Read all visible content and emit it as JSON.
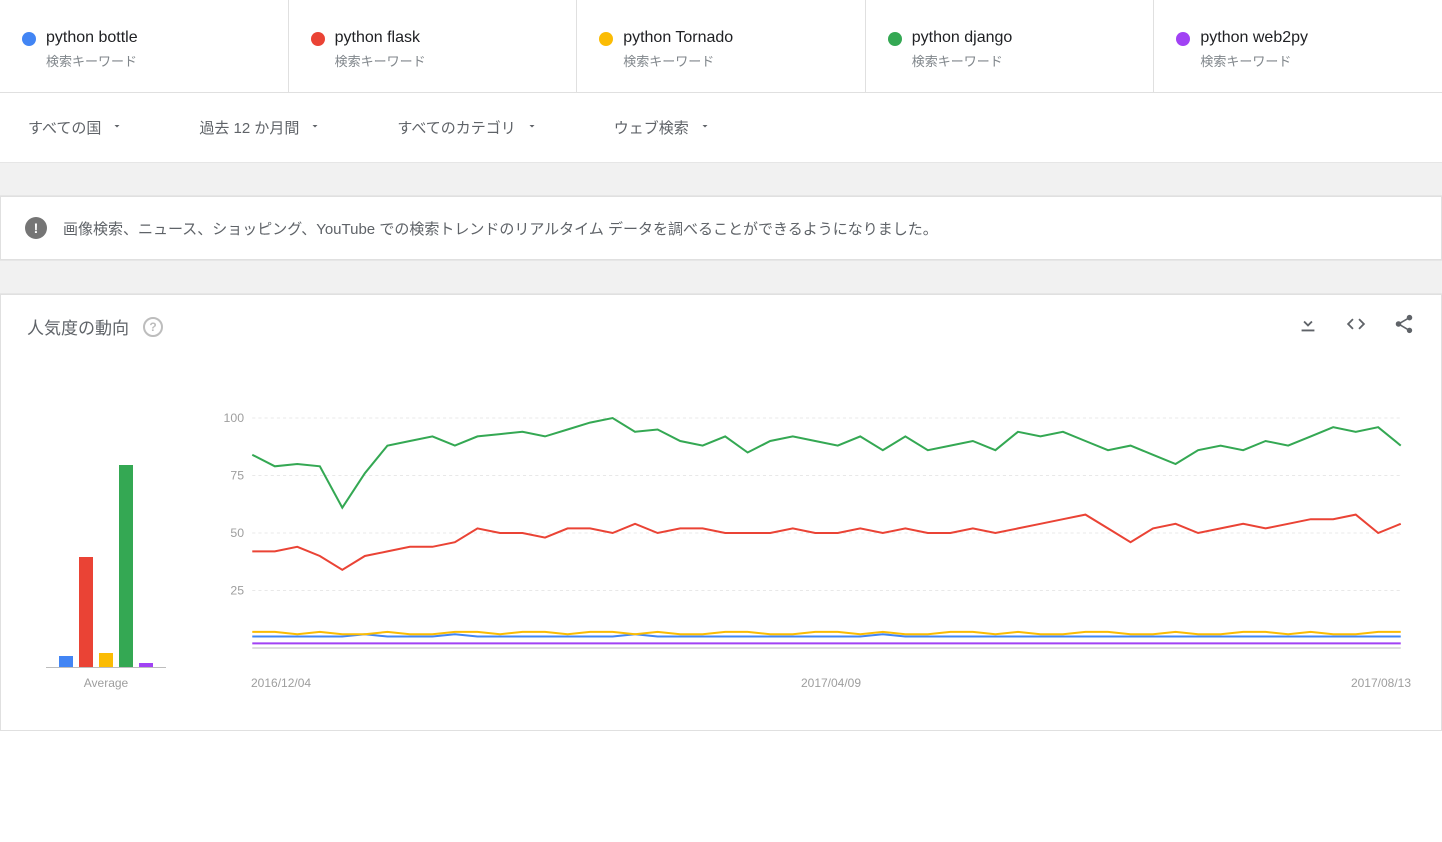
{
  "terms": [
    {
      "label": "python bottle",
      "sub": "検索キーワード",
      "color": "#4285F4"
    },
    {
      "label": "python flask",
      "sub": "検索キーワード",
      "color": "#EA4335"
    },
    {
      "label": "python Tornado",
      "sub": "検索キーワード",
      "color": "#FBBC04"
    },
    {
      "label": "python django",
      "sub": "検索キーワード",
      "color": "#34A853"
    },
    {
      "label": "python web2py",
      "sub": "検索キーワード",
      "color": "#A142F4"
    }
  ],
  "filters": {
    "region": "すべての国",
    "time": "過去 12 か月間",
    "category": "すべてのカテゴリ",
    "search_type": "ウェブ検索"
  },
  "banner": {
    "text": "画像検索、ニュース、ショッピング、YouTube での検索トレンドのリアルタイム データを調べることができるようになりました。"
  },
  "chart": {
    "title": "人気度の動向",
    "avg_label": "Average"
  },
  "chart_data": {
    "type": "line",
    "ylim": [
      0,
      100
    ],
    "yticks": [
      25,
      50,
      75,
      100
    ],
    "x_labels": [
      "2016/12/04",
      "2017/04/09",
      "2017/08/13"
    ],
    "averages": {
      "bottle": 5,
      "flask": 48,
      "tornado": 6,
      "django": 88,
      "web2py": 2
    },
    "series": [
      {
        "name": "python bottle",
        "color": "#4285F4",
        "values": [
          5,
          5,
          5,
          5,
          5,
          6,
          5,
          5,
          5,
          6,
          5,
          5,
          5,
          5,
          5,
          5,
          5,
          6,
          5,
          5,
          5,
          5,
          5,
          5,
          5,
          5,
          5,
          5,
          6,
          5,
          5,
          5,
          5,
          5,
          5,
          5,
          5,
          5,
          5,
          5,
          5,
          5,
          5,
          5,
          5,
          5,
          5,
          5,
          5,
          5,
          5,
          5
        ]
      },
      {
        "name": "python flask",
        "color": "#EA4335",
        "values": [
          42,
          42,
          44,
          40,
          34,
          40,
          42,
          44,
          44,
          46,
          52,
          50,
          50,
          48,
          52,
          52,
          50,
          54,
          50,
          52,
          52,
          50,
          50,
          50,
          52,
          50,
          50,
          52,
          50,
          52,
          50,
          50,
          52,
          50,
          52,
          54,
          56,
          58,
          52,
          46,
          52,
          54,
          50,
          52,
          54,
          52,
          54,
          56,
          56,
          58,
          50,
          54
        ]
      },
      {
        "name": "python Tornado",
        "color": "#FBBC04",
        "values": [
          7,
          7,
          6,
          7,
          6,
          6,
          7,
          6,
          6,
          7,
          7,
          6,
          7,
          7,
          6,
          7,
          7,
          6,
          7,
          6,
          6,
          7,
          7,
          6,
          6,
          7,
          7,
          6,
          7,
          6,
          6,
          7,
          7,
          6,
          7,
          6,
          6,
          7,
          7,
          6,
          6,
          7,
          6,
          6,
          7,
          7,
          6,
          7,
          6,
          6,
          7,
          7
        ]
      },
      {
        "name": "python django",
        "color": "#34A853",
        "values": [
          84,
          79,
          80,
          79,
          61,
          76,
          88,
          90,
          92,
          88,
          92,
          93,
          94,
          92,
          95,
          98,
          100,
          94,
          95,
          90,
          88,
          92,
          85,
          90,
          92,
          90,
          88,
          92,
          86,
          92,
          86,
          88,
          90,
          86,
          94,
          92,
          94,
          90,
          86,
          88,
          84,
          80,
          86,
          88,
          86,
          90,
          88,
          92,
          96,
          94,
          96,
          88
        ]
      },
      {
        "name": "python web2py",
        "color": "#A142F4",
        "values": [
          2,
          2,
          2,
          2,
          2,
          2,
          2,
          2,
          2,
          2,
          2,
          2,
          2,
          2,
          2,
          2,
          2,
          2,
          2,
          2,
          2,
          2,
          2,
          2,
          2,
          2,
          2,
          2,
          2,
          2,
          2,
          2,
          2,
          2,
          2,
          2,
          2,
          2,
          2,
          2,
          2,
          2,
          2,
          2,
          2,
          2,
          2,
          2,
          2,
          2,
          2,
          2
        ]
      }
    ]
  }
}
